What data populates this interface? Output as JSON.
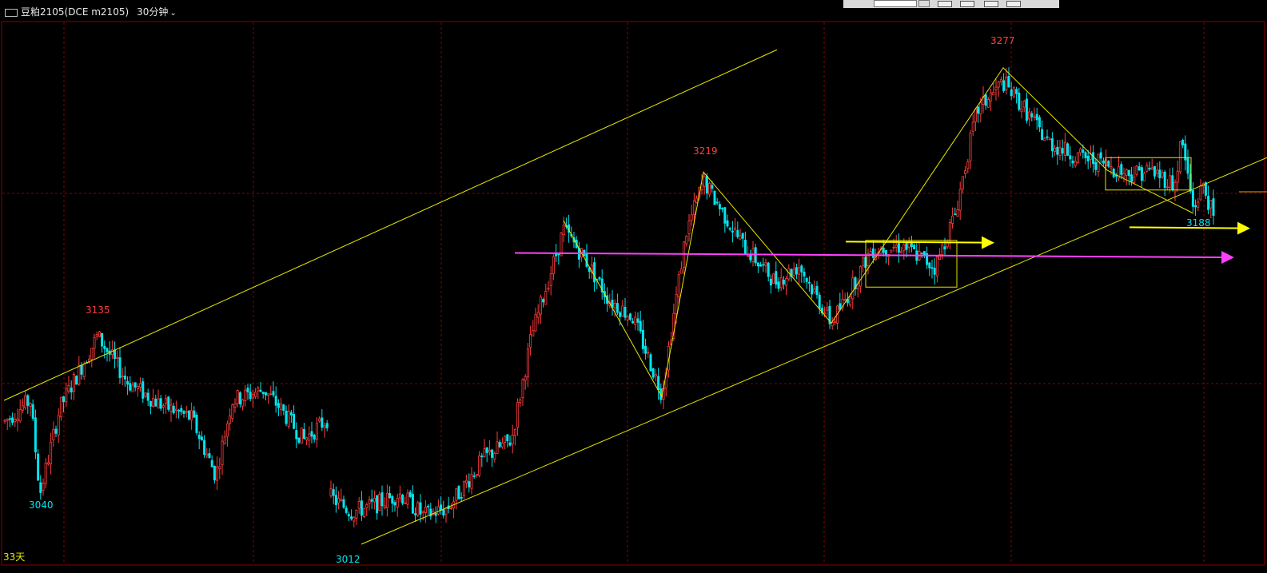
{
  "window": {
    "symbol_title": "豆粕2105(DCE m2105)",
    "period": "30分钟",
    "span_label": "33天"
  },
  "colors": {
    "background": "#000000",
    "up_candle": "#ff3b3b",
    "down_candle": "#00e5ee",
    "grid": "#8b0000",
    "channel": "#e6e600",
    "resistance": "#ff40ff",
    "arrow": "#ffff00"
  },
  "chart_data": {
    "type": "candlestick",
    "title": "",
    "price_range": [
      3000,
      3293
    ],
    "annotations": [
      {
        "label": "3135",
        "kind": "high",
        "color": "#ff4040"
      },
      {
        "label": "3040",
        "kind": "low",
        "color": "#00e5ee"
      },
      {
        "label": "3012",
        "kind": "low",
        "color": "#00e5ee"
      },
      {
        "label": "3219",
        "kind": "high",
        "color": "#ff4040"
      },
      {
        "label": "3277",
        "kind": "high",
        "color": "#ff4040"
      },
      {
        "label": "3188",
        "kind": "low",
        "color": "#00e5ee"
      }
    ],
    "trend_lines": [
      {
        "name": "upper-channel",
        "style": "yellow line",
        "from_price": 3092,
        "to_price": 3287
      },
      {
        "name": "lower-channel",
        "style": "yellow line",
        "from_price": 3012,
        "to_price": 3227
      },
      {
        "name": "magenta-resistance",
        "style": "magenta arrow",
        "price": 3173
      },
      {
        "name": "yellow-arrow-1",
        "style": "yellow arrow",
        "price": 3180
      },
      {
        "name": "yellow-arrow-2",
        "style": "yellow arrow",
        "price": 3188
      }
    ],
    "grid": true,
    "legend": "none"
  }
}
